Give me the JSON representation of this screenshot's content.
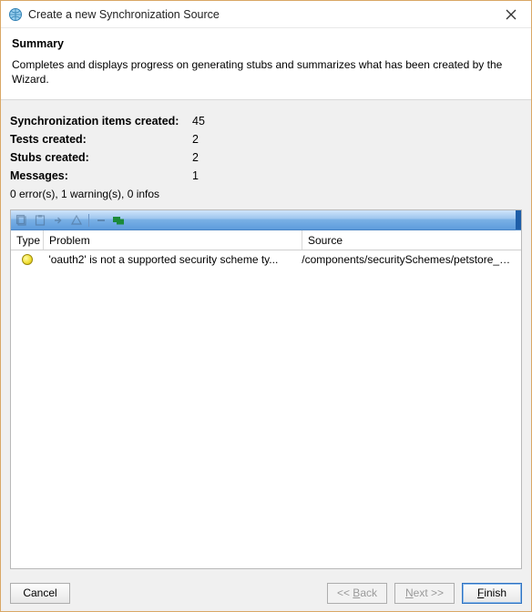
{
  "window": {
    "title": "Create a new Synchronization Source"
  },
  "header": {
    "title": "Summary",
    "description": "Completes and displays progress on generating stubs and summarizes what has been created by the Wizard."
  },
  "stats": {
    "sync_label": "Synchronization items created:",
    "sync_value": "45",
    "tests_label": "Tests created:",
    "tests_value": "2",
    "stubs_label": "Stubs created:",
    "stubs_value": "2",
    "messages_label": "Messages:",
    "messages_value": "1",
    "messages_summary": "0 error(s), 1 warning(s), 0 infos"
  },
  "table": {
    "columns": {
      "type": "Type",
      "problem": "Problem",
      "source": "Source"
    },
    "rows": [
      {
        "type_icon": "warning-icon",
        "problem": "'oauth2' is not a supported security scheme ty...",
        "source": "/components/securitySchemes/petstore_auth"
      }
    ]
  },
  "buttons": {
    "cancel": "Cancel",
    "back_prefix": "<< ",
    "back_letter": "B",
    "back_rest": "ack",
    "next_letter": "N",
    "next_rest": "ext >>",
    "finish_letter": "F",
    "finish_rest": "inish"
  }
}
